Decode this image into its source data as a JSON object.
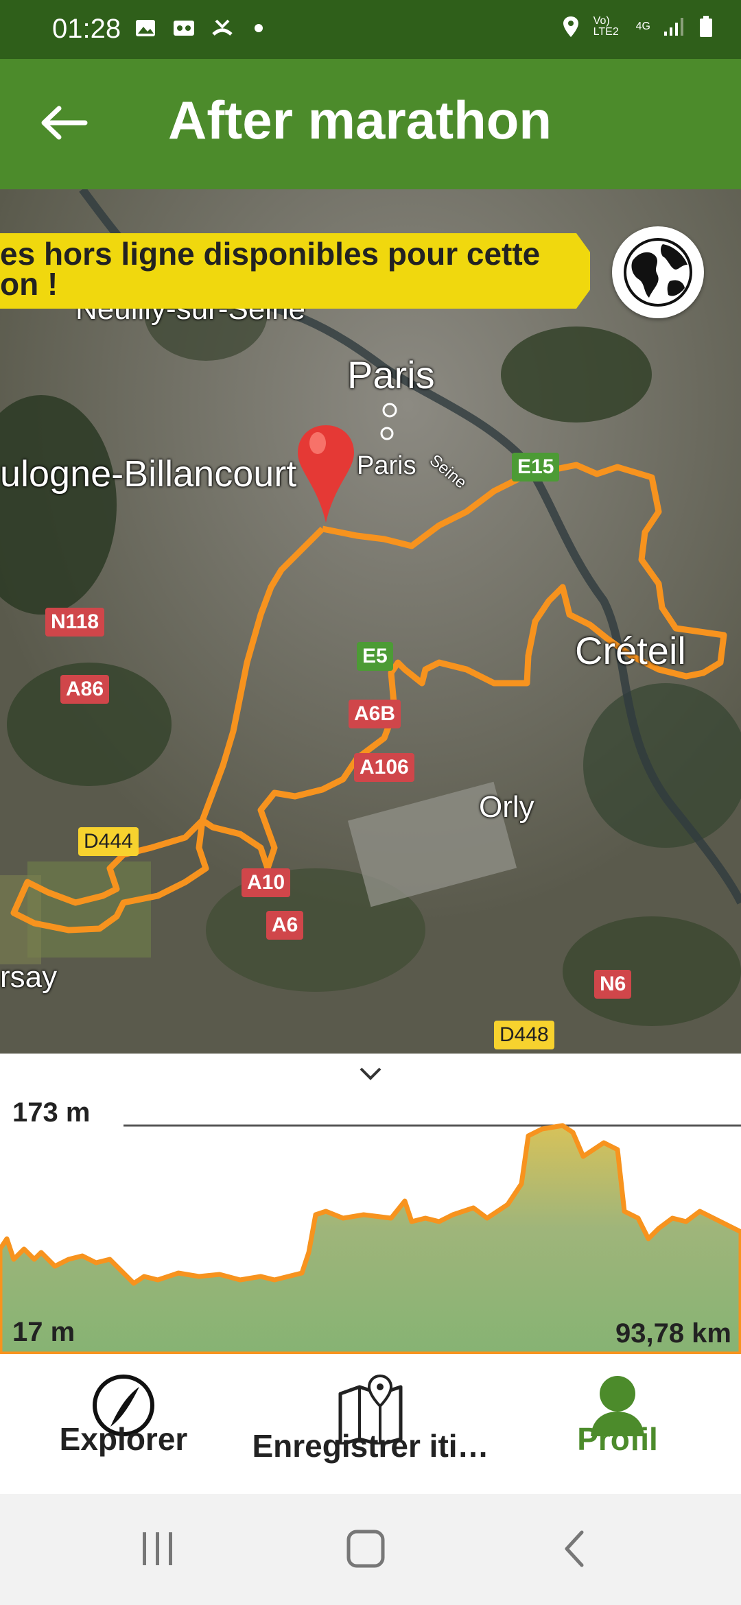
{
  "status_bar": {
    "time": "01:28",
    "network": "Vo) LTE2",
    "network_type": "4G"
  },
  "app_bar": {
    "title": "After marathon"
  },
  "map": {
    "offline_banner": "es hors ligne disponibles pour cette\non !",
    "places": {
      "neuilly": "Neuilly-sur-Seine",
      "paris_large": "Paris",
      "paris_small": "Paris",
      "seine": "Seine",
      "boulogne": "ulogne-Billancourt",
      "creteil": "Créteil",
      "orly": "Orly",
      "orsay": "rsay"
    },
    "roads": {
      "e15": "E15",
      "n118": "N118",
      "a86": "A86",
      "e5": "E5",
      "a6b": "A6B",
      "a106": "A106",
      "d444": "D444",
      "a10": "A10",
      "a6": "A6",
      "n6": "N6",
      "d448": "D448"
    },
    "colors": {
      "route": "#f7931e",
      "banner": "#f0d80e"
    }
  },
  "elevation": {
    "max_label": "173 m",
    "min_label": "17 m",
    "distance_label": "93,78 km",
    "max_m": 173,
    "min_m": 17,
    "distance_km": 93.78
  },
  "bottom_nav": {
    "explorer": "Explorer",
    "record": "Enregistrer iti…",
    "profile": "Profil"
  }
}
